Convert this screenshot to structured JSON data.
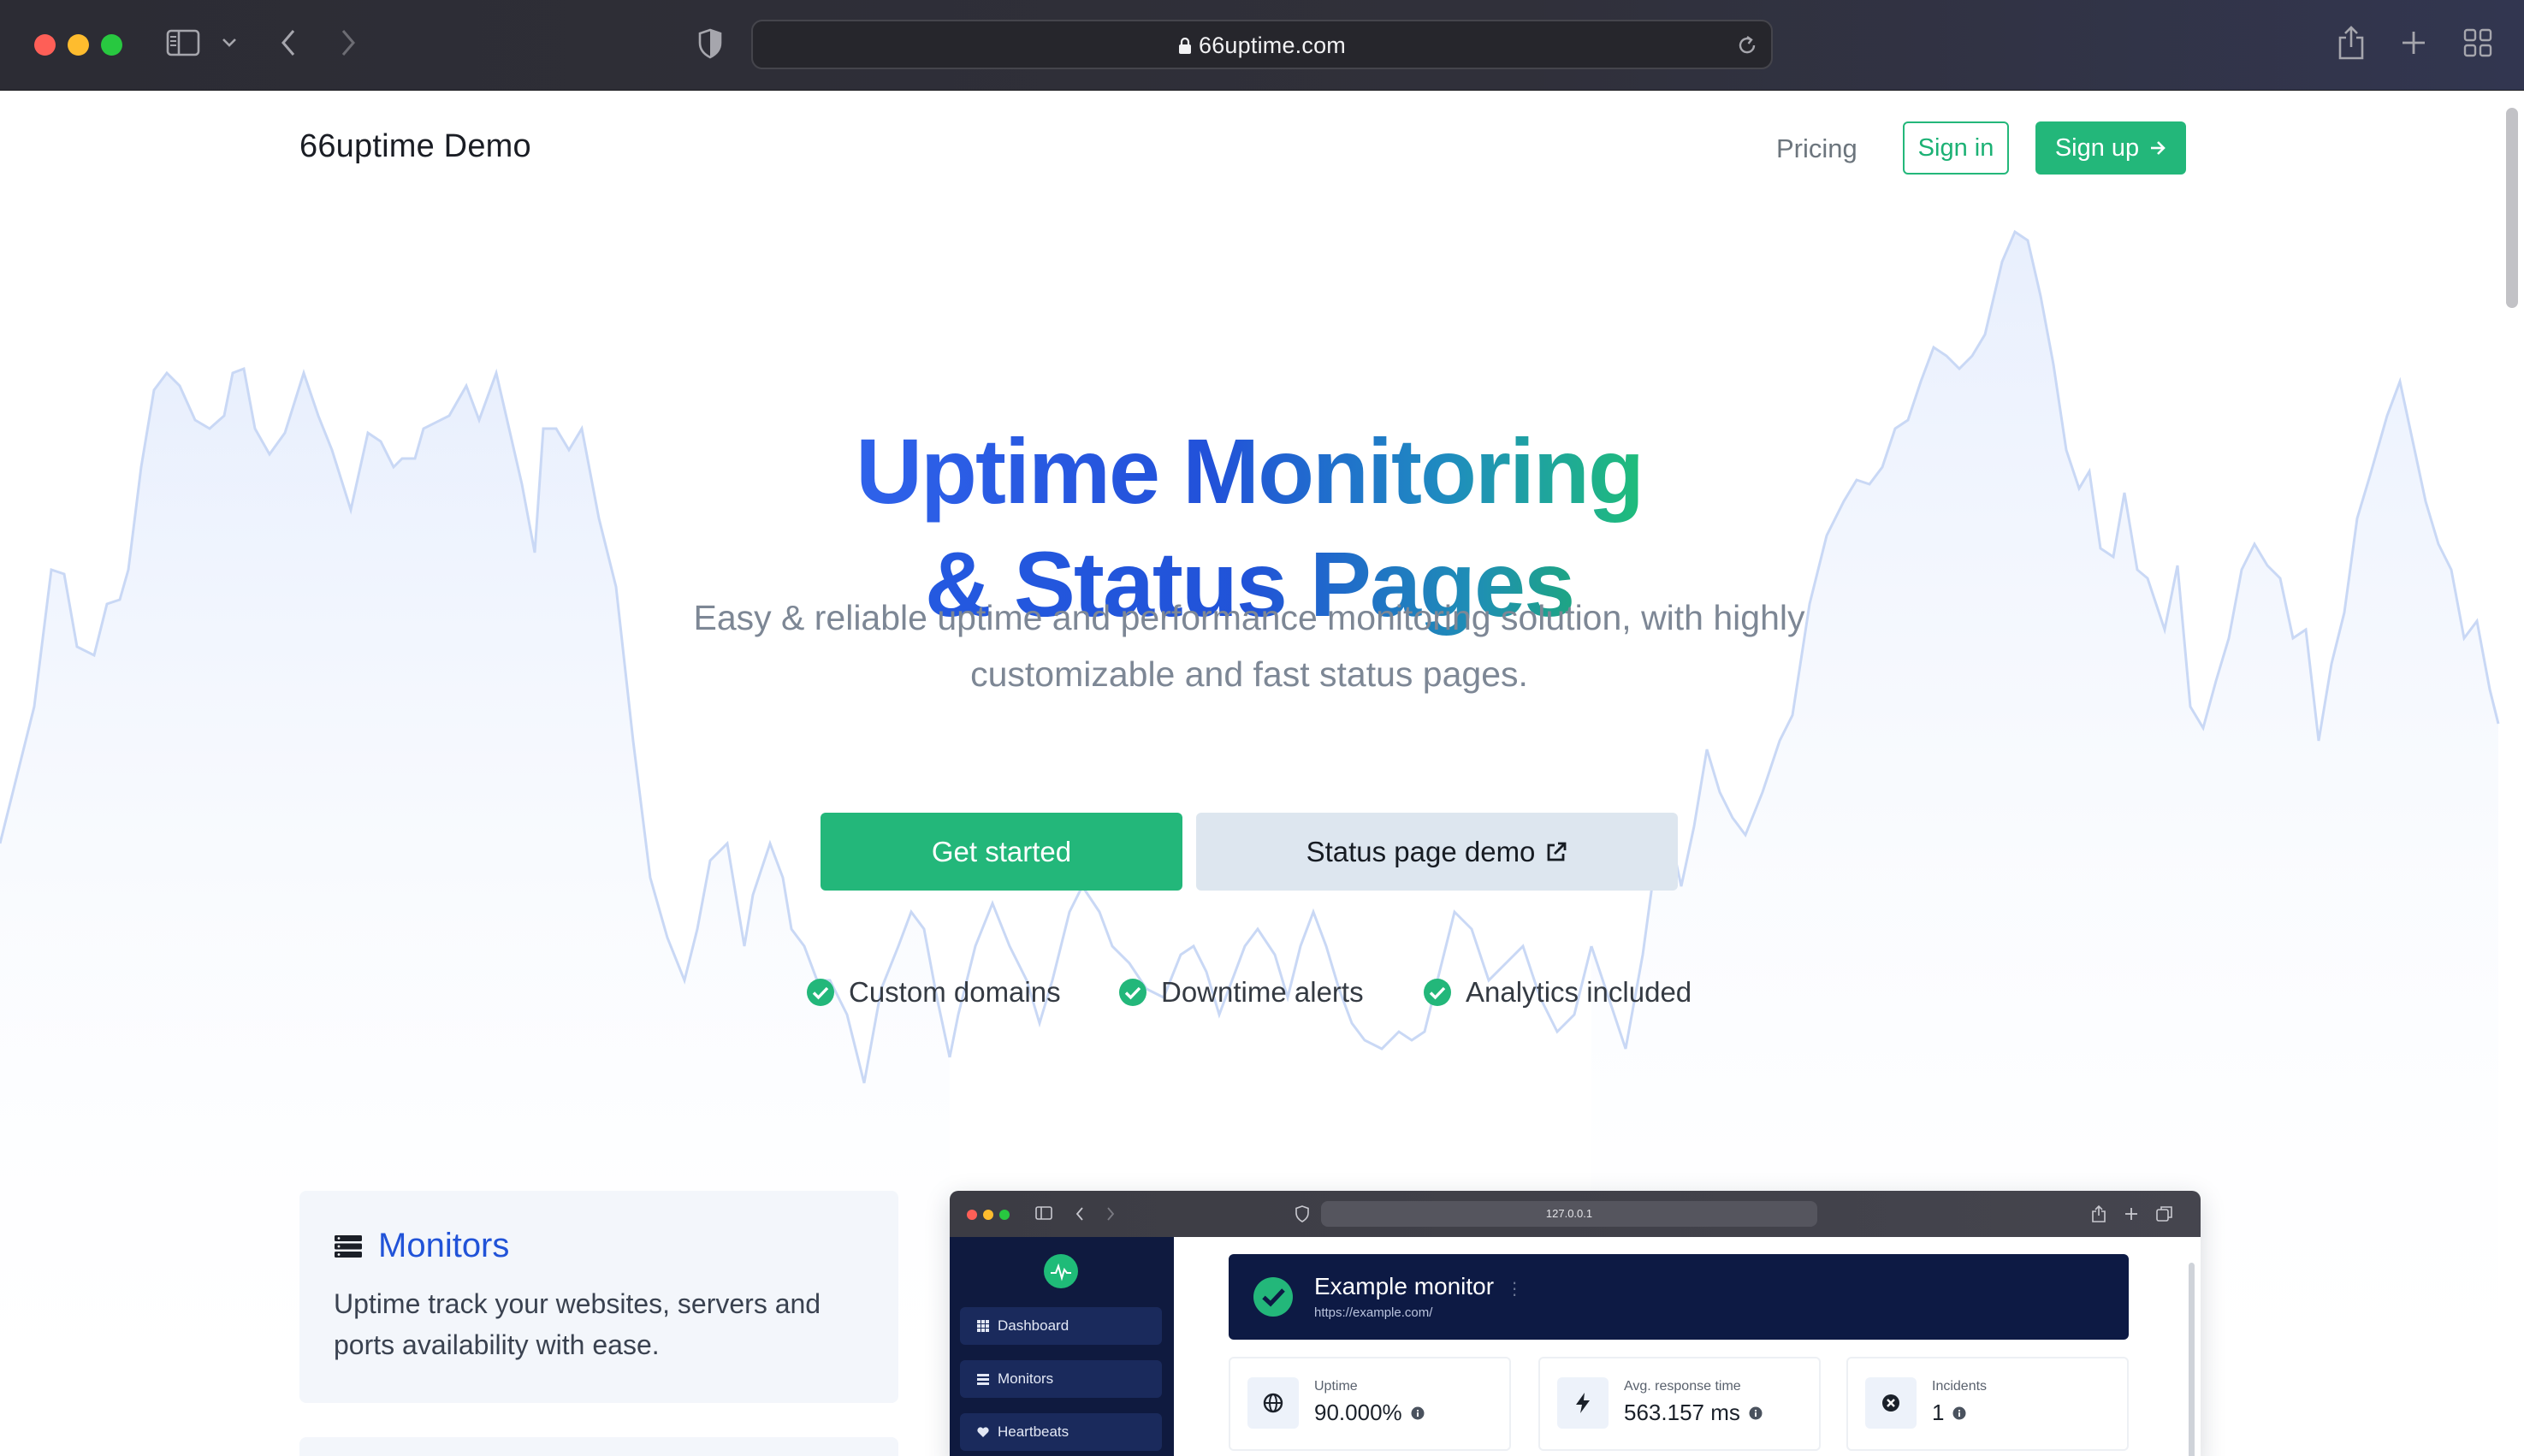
{
  "browser": {
    "url": "66uptime.com"
  },
  "nav": {
    "brand": "66uptime Demo",
    "pricing": "Pricing",
    "sign_in": "Sign in",
    "sign_up": "Sign up"
  },
  "hero": {
    "title_line1": "Uptime Monitoring",
    "title_line2": "& Status Pages",
    "subtitle_line1": "Easy & reliable uptime and performance monitoring solution, with highly",
    "subtitle_line2": "customizable and fast status pages.",
    "cta_primary": "Get started",
    "cta_secondary": "Status page demo",
    "features": [
      "Custom domains",
      "Downtime alerts",
      "Analytics included"
    ]
  },
  "card": {
    "title": "Monitors",
    "text": "Uptime track your websites, servers and ports availability with ease."
  },
  "preview": {
    "url": "127.0.0.1",
    "nav": [
      "Dashboard",
      "Monitors",
      "Heartbeats"
    ],
    "monitor_title": "Example monitor",
    "monitor_url": "https://example.com/",
    "stats": [
      {
        "label": "Uptime",
        "value": "90.000%"
      },
      {
        "label": "Avg. response time",
        "value": "563.157 ms"
      },
      {
        "label": "Incidents",
        "value": "1"
      }
    ]
  },
  "colors": {
    "accent_green": "#23b77a",
    "accent_blue": "#2153d8",
    "chart_line": "#c9d8f5",
    "chart_fill": "#eef3fd"
  },
  "icons": {
    "card": "server-stack-icon",
    "check": "check-circle-icon",
    "external": "external-link-icon",
    "sign_up": "arrow-right-icon"
  }
}
